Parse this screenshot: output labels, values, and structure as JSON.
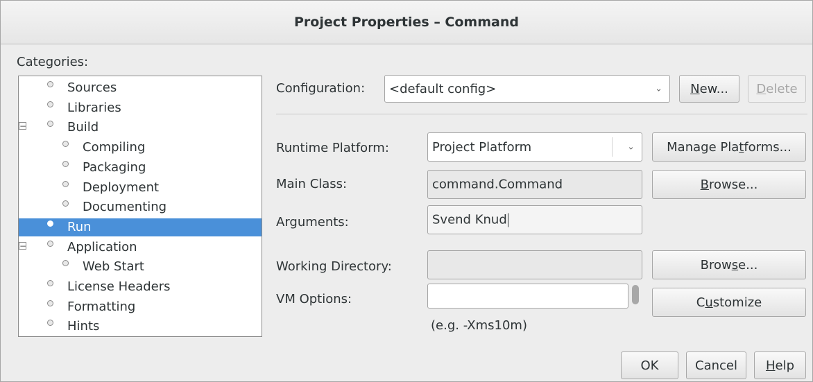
{
  "window": {
    "title": "Project Properties – Command"
  },
  "categories": {
    "label": "Categories:",
    "items": [
      {
        "label": "Sources",
        "level": 1,
        "expander": "",
        "selected": false
      },
      {
        "label": "Libraries",
        "level": 1,
        "expander": "",
        "selected": false
      },
      {
        "label": "Build",
        "level": 1,
        "expander": "−",
        "selected": false
      },
      {
        "label": "Compiling",
        "level": 2,
        "expander": "",
        "selected": false
      },
      {
        "label": "Packaging",
        "level": 2,
        "expander": "",
        "selected": false
      },
      {
        "label": "Deployment",
        "level": 2,
        "expander": "",
        "selected": false
      },
      {
        "label": "Documenting",
        "level": 2,
        "expander": "",
        "selected": false
      },
      {
        "label": "Run",
        "level": 1,
        "expander": "",
        "selected": true
      },
      {
        "label": "Application",
        "level": 1,
        "expander": "−",
        "selected": false
      },
      {
        "label": "Web Start",
        "level": 2,
        "expander": "",
        "selected": false
      },
      {
        "label": "License Headers",
        "level": 1,
        "expander": "",
        "selected": false
      },
      {
        "label": "Formatting",
        "level": 1,
        "expander": "",
        "selected": false
      },
      {
        "label": "Hints",
        "level": 1,
        "expander": "",
        "selected": false
      }
    ]
  },
  "configuration": {
    "label": "Configuration:",
    "value": "<default config>",
    "new_button_pre": "",
    "new_button_u": "N",
    "new_button_post": "ew...",
    "delete_button_pre": "",
    "delete_button_u": "D",
    "delete_button_post": "elete"
  },
  "runtime_platform": {
    "label": "Runtime Platform:",
    "value": "Project Platform",
    "manage_pre": "Manage Pla",
    "manage_u": "t",
    "manage_post": "forms..."
  },
  "main_class": {
    "label": "Main Class:",
    "value": "command.Command",
    "browse_pre": "",
    "browse_u": "B",
    "browse_post": "rowse..."
  },
  "arguments": {
    "label": "Arguments:",
    "value": "Svend Knud"
  },
  "working_directory": {
    "label": "Working Directory:",
    "value": "",
    "browse_pre": "Brow",
    "browse_u": "s",
    "browse_post": "e..."
  },
  "vm_options": {
    "label": "VM Options:",
    "value": "",
    "customize_pre": "C",
    "customize_u": "u",
    "customize_post": "stomize",
    "hint": "(e.g. -Xms10m)"
  },
  "footer": {
    "ok_label": "OK",
    "cancel_label": "Cancel",
    "help_pre": "",
    "help_u": "H",
    "help_post": "elp"
  }
}
